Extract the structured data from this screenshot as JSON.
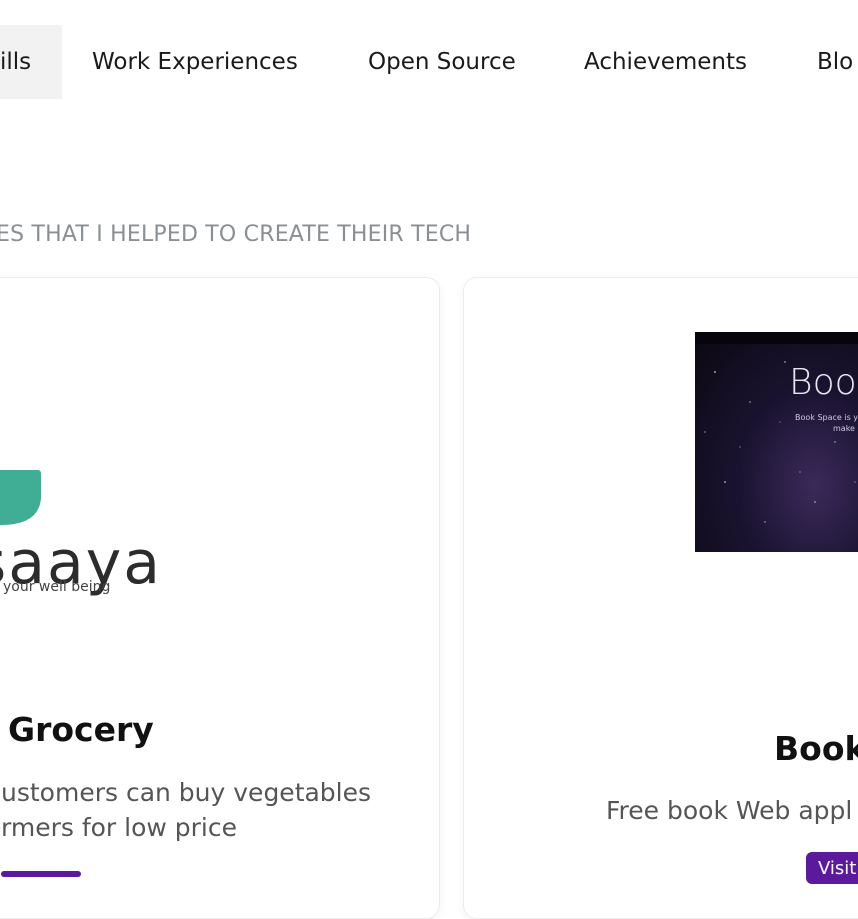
{
  "nav": {
    "items": [
      {
        "label": "ills",
        "active": true
      },
      {
        "label": "Work Experiences",
        "active": false
      },
      {
        "label": "Open Source",
        "active": false
      },
      {
        "label": "Achievements",
        "active": false
      },
      {
        "label": "Blo",
        "active": false
      }
    ]
  },
  "section": {
    "subtitle": "ES THAT I HELPED TO CREATE THEIR TECH"
  },
  "cards": [
    {
      "logo": {
        "wordmark": "saaya",
        "tagline": "your well being",
        "leaf_color": "#3fae94"
      },
      "title": "Grocery",
      "description_lines": [
        "ustomers can buy vegetables",
        "rmers for low price"
      ],
      "visit_label": ""
    },
    {
      "image": {
        "title": "Boo",
        "caption_lines": [
          "Book Space is your",
          "make o"
        ]
      },
      "title": "Book",
      "description_lines": [
        "Free book Web appl"
      ],
      "visit_label": "Visit"
    }
  ],
  "colors": {
    "accent": "#5b1a9e",
    "subtitle": "#8a8f94",
    "logo_leaf": "#3fae94"
  }
}
